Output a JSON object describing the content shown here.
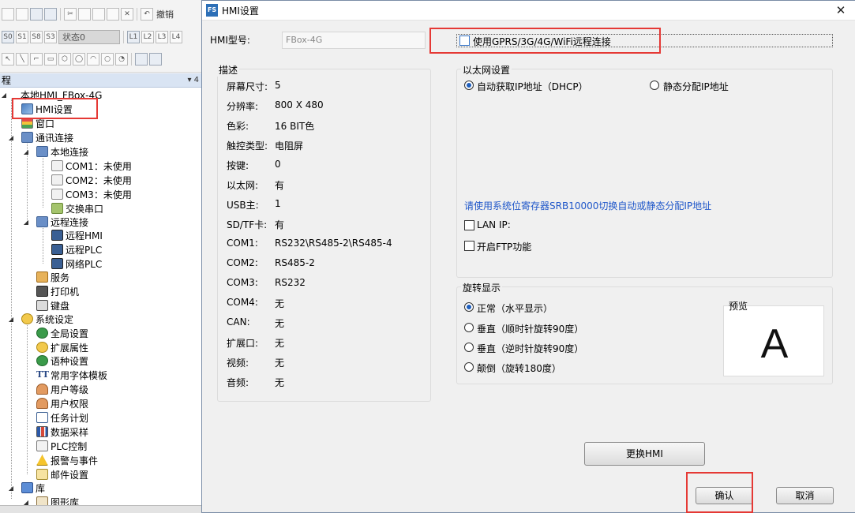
{
  "app": {
    "undo_label": "撤销",
    "state_value": "状态0",
    "toolbar_state_buttons": [
      "S0",
      "S1",
      "S8",
      "S3"
    ],
    "toolbar_layer_buttons": [
      "L1",
      "L2",
      "L3",
      "L4"
    ],
    "panel_title": "程",
    "panel_pin": "▾ 4"
  },
  "tree": {
    "root": "本地HMI_FBox-4G",
    "hmi_settings": "HMI设置",
    "window": "窗口",
    "comm": "通讯连接",
    "local_conn": "本地连接",
    "com1": "COM1：未使用",
    "com2": "COM2：未使用",
    "com3": "COM3：未使用",
    "swap_port": "交换串口",
    "remote_conn": "远程连接",
    "remote_hmi": "远程HMI",
    "remote_plc": "远程PLC",
    "net_plc": "网络PLC",
    "service": "服务",
    "printer": "打印机",
    "keyboard": "键盘",
    "system": "系统设定",
    "global": "全局设置",
    "ext_attr": "扩展属性",
    "lang": "语种设置",
    "font_tpl": "常用字体模板",
    "user_level": "用户等级",
    "user_perm": "用户权限",
    "task": "任务计划",
    "data_sampling": "数据采样",
    "plc_ctrl": "PLC控制",
    "alarm": "报警与事件",
    "mail": "邮件设置",
    "library": "库",
    "graphics_lib": "图形库"
  },
  "dialog": {
    "title": "HMI设置",
    "icon_text": "FS",
    "close": "✕",
    "model_label": "HMI型号:",
    "model_value": "FBox-4G",
    "gprs_label": "使用GPRS/3G/4G/WiFi远程连接",
    "desc_title": "描述",
    "desc_rows": [
      {
        "k": "屏幕尺寸:",
        "v": "5"
      },
      {
        "k": "分辨率:",
        "v": "800 X 480"
      },
      {
        "k": "色彩:",
        "v": "16 BIT色"
      },
      {
        "k": "触控类型:",
        "v": "电阻屏"
      },
      {
        "k": "按键:",
        "v": "0"
      },
      {
        "k": "以太网:",
        "v": "有"
      },
      {
        "k": "USB主:",
        "v": "1"
      },
      {
        "k": "SD/TF卡:",
        "v": "有"
      },
      {
        "k": "COM1:",
        "v": "RS232\\RS485-2\\RS485-4"
      },
      {
        "k": "COM2:",
        "v": "RS485-2"
      },
      {
        "k": "COM3:",
        "v": "RS232"
      },
      {
        "k": "COM4:",
        "v": "无"
      },
      {
        "k": "CAN:",
        "v": "无"
      },
      {
        "k": "扩展口:",
        "v": "无"
      },
      {
        "k": "视频:",
        "v": "无"
      },
      {
        "k": "音频:",
        "v": "无"
      }
    ],
    "eth_title": "以太网设置",
    "eth_dhcp": "自动获取IP地址（DHCP）",
    "eth_static": "静态分配IP地址",
    "eth_note": "请使用系统位寄存器SRB10000切换自动或静态分配IP地址",
    "lan_ip": "LAN IP:",
    "ftp": "开启FTP功能",
    "rot_title": "旋转显示",
    "rot_normal": "正常（水平显示）",
    "rot_cw": "垂直（顺时针旋转90度）",
    "rot_ccw": "垂直（逆时针旋转90度）",
    "rot_flip": "颠倒（旋转180度）",
    "preview_title": "预览",
    "preview_letter": "A",
    "change_hmi": "更换HMI",
    "ok": "确认",
    "cancel": "取消",
    "highlight_color": "#e53935"
  }
}
